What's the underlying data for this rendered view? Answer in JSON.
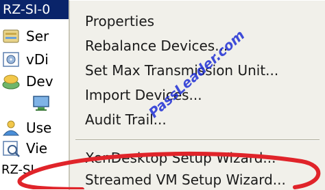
{
  "tree": {
    "header_label": "RZ-SI-0",
    "items": [
      {
        "label": "Ser",
        "icon": "server-icon"
      },
      {
        "label": "vDi",
        "icon": "vdisk-icon"
      },
      {
        "label": "Dev",
        "icon": "devices-icon"
      },
      {
        "label": "",
        "icon": "monitor-icon"
      },
      {
        "label": "Use",
        "icon": "users-icon"
      },
      {
        "label": "Vie",
        "icon": "views-icon"
      }
    ],
    "footer_label": "RZ-SI"
  },
  "menu": {
    "items": [
      {
        "label": "Properties"
      },
      {
        "label": "Rebalance Devices..."
      },
      {
        "label": "Set Max Transmission Unit..."
      },
      {
        "label": "Import Devices..."
      },
      {
        "label": "Audit Trail..."
      },
      {
        "label": "XenDesktop Setup Wizard..."
      },
      {
        "label": "Streamed VM Setup Wizard..."
      }
    ]
  },
  "watermark": "PassLeader.com",
  "colors": {
    "tree_header_bg": "#0a246a",
    "menu_bg": "#f1f0ea",
    "highlight_ellipse": "#e0242a",
    "watermark": "#1f2fd6"
  }
}
